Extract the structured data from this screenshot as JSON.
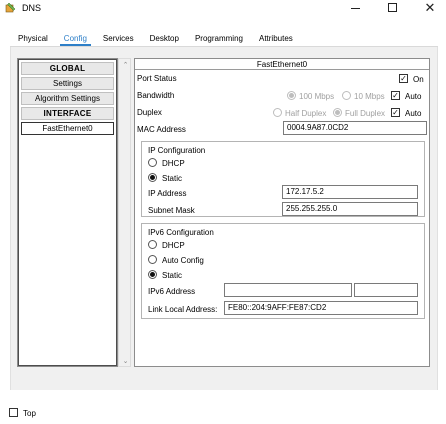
{
  "window": {
    "title": "DNS",
    "icon": "gear-pencil-icon"
  },
  "tabs": [
    {
      "label": "Physical",
      "active": false
    },
    {
      "label": "Config",
      "active": true
    },
    {
      "label": "Services",
      "active": false
    },
    {
      "label": "Desktop",
      "active": false
    },
    {
      "label": "Programming",
      "active": false
    },
    {
      "label": "Attributes",
      "active": false
    }
  ],
  "sidebar": {
    "items": [
      {
        "label": "GLOBAL",
        "type": "header"
      },
      {
        "label": "Settings",
        "type": "item"
      },
      {
        "label": "Algorithm Settings",
        "type": "item"
      },
      {
        "label": "INTERFACE",
        "type": "header"
      },
      {
        "label": "FastEthernet0",
        "type": "item",
        "selected": true
      }
    ]
  },
  "interface": {
    "title": "FastEthernet0",
    "port_status": {
      "label": "Port Status",
      "on_label": "On",
      "on_checked": true
    },
    "bandwidth": {
      "label": "Bandwidth",
      "opt1": "100 Mbps",
      "opt2": "10 Mbps",
      "auto_label": "Auto",
      "auto_checked": true
    },
    "duplex": {
      "label": "Duplex",
      "opt1": "Half Duplex",
      "opt2": "Full Duplex",
      "auto_label": "Auto",
      "auto_checked": true
    },
    "mac": {
      "label": "MAC Address",
      "value": "0004.9A87.0CD2"
    }
  },
  "ip_config": {
    "title": "IP Configuration",
    "dhcp_label": "DHCP",
    "static_label": "Static",
    "selected": "static",
    "ip_label": "IP Address",
    "ip_value": "172.17.5.2",
    "mask_label": "Subnet Mask",
    "mask_value": "255.255.255.0"
  },
  "ipv6_config": {
    "title": "IPv6 Configuration",
    "dhcp_label": "DHCP",
    "auto_label": "Auto Config",
    "static_label": "Static",
    "selected": "static",
    "addr_label": "IPv6 Address",
    "addr_value": "",
    "prefix_value": "",
    "link_local_label": "Link Local Address:",
    "link_local_value": "FE80::204:9AFF:FE87:CD2"
  },
  "footer": {
    "top_label": "Top",
    "top_checked": false
  },
  "colors": {
    "accent": "#2d7fc8",
    "panel_bg": "#f0f0f0",
    "disabled_text": "#a0a0a0"
  }
}
